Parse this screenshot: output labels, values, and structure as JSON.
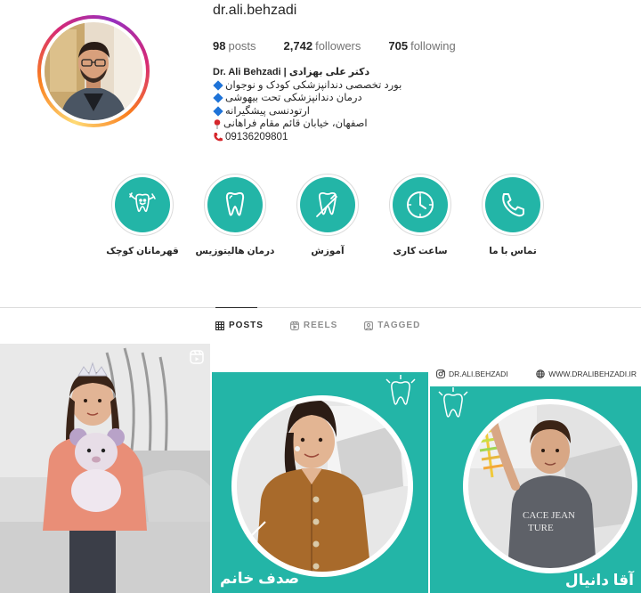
{
  "profile": {
    "username": "dr.ali.behzadi",
    "stats": {
      "posts_count": "98",
      "posts_label": "posts",
      "followers_count": "2,742",
      "followers_label": "followers",
      "following_count": "705",
      "following_label": "following"
    },
    "bio": {
      "name": "Dr. Ali Behzadi | دکتر علی بهزادی",
      "line1": "بورد تخصصی دندانپزشکی کودک و نوجوان",
      "line2": "درمان دندانپزشکی تحت بیهوشی",
      "line3": "ارتودنسی پیشگیرانه",
      "address": "اصفهان، خیابان قائم مقام فراهانی",
      "phone": "09136209801"
    }
  },
  "highlights": [
    {
      "label": "قهرمانان کوچک",
      "icon": "tooth-hero-icon"
    },
    {
      "label": "درمان هالیتوزیس",
      "icon": "tooth-icon"
    },
    {
      "label": "آموزش",
      "icon": "toothbrush-tooth-icon"
    },
    {
      "label": "ساعت کاری",
      "icon": "clock-icon"
    },
    {
      "label": "تماس با ما",
      "icon": "phone-icon"
    }
  ],
  "tabs": {
    "posts": "POSTS",
    "reels": "REELS",
    "tagged": "TAGGED"
  },
  "posts": [
    {
      "type": "reel",
      "caption": ""
    },
    {
      "type": "image",
      "caption": "صدف خانم"
    },
    {
      "type": "image",
      "caption": "آقا دانیال",
      "handle": "DR.ALI.BEHZADI",
      "website": "WWW.DRALIBEHZADI.IR"
    }
  ],
  "colors": {
    "accent_teal": "#23b5a7",
    "bio_diamond": "#1e73d8",
    "text": "#262626",
    "muted": "#737373"
  }
}
